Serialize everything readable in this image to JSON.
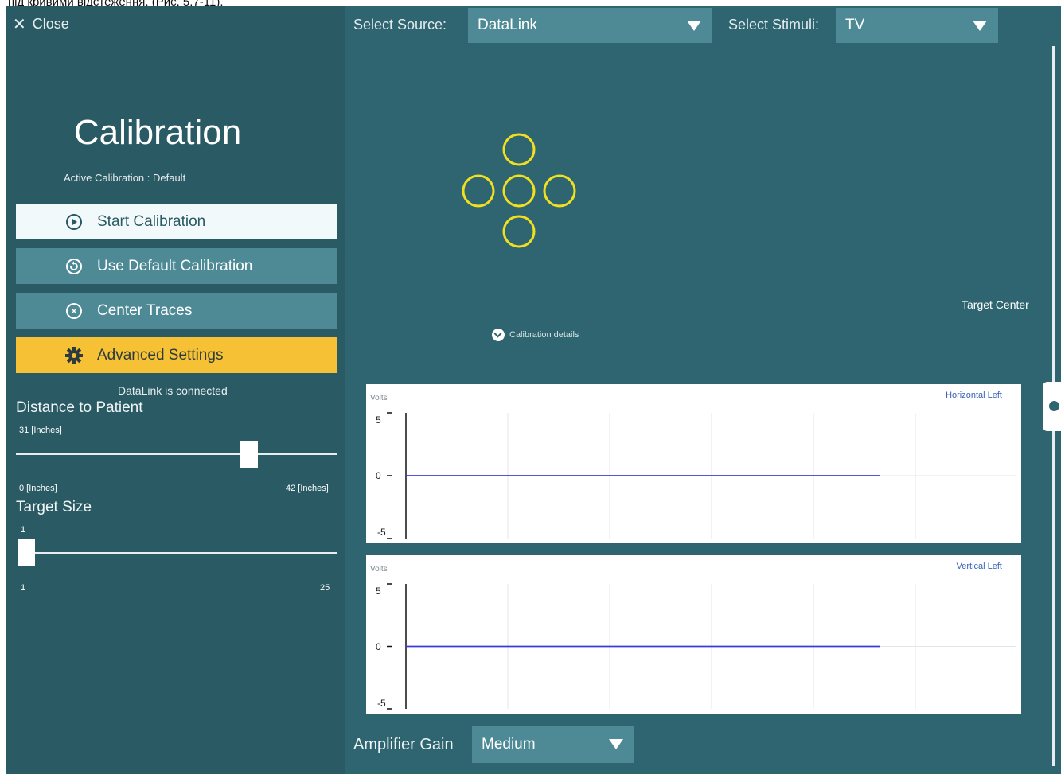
{
  "doc_caption": "під кривими відстеження, (Рис. 5.7-11).",
  "left_panel": {
    "close_label": "Close",
    "title": "Calibration",
    "active_calibration": "Active Calibration : Default",
    "buttons": {
      "start": "Start Calibration",
      "use_default": "Use Default Calibration",
      "center_traces": "Center Traces",
      "advanced": "Advanced Settings"
    },
    "connection_status": "DataLink is connected",
    "distance": {
      "label": "Distance to Patient",
      "current": "31 [Inches]",
      "min": "0 [Inches]",
      "max": "42 [Inches]",
      "value": 31,
      "range": [
        0,
        42
      ]
    },
    "target_size": {
      "label": "Target Size",
      "current": "1",
      "min": "1",
      "max": "25",
      "value": 1,
      "range": [
        1,
        25
      ]
    }
  },
  "topbar": {
    "source_label": "Select Source:",
    "source_value": "DataLink",
    "stimuli_label": "Select Stimuli:",
    "stimuli_value": "TV"
  },
  "stimulus": {
    "target_center_label": "Target Center",
    "calibration_details": "Calibration details",
    "target_color": "#f0e020"
  },
  "plots": [
    {
      "title": "Horizontal Left",
      "ylabel": "Volts",
      "y_ticks": [
        "5",
        "0",
        "-5"
      ],
      "ylim": [
        -5,
        5
      ],
      "trace_value": 0,
      "trace_color": "#3b3bd6"
    },
    {
      "title": "Vertical Left",
      "ylabel": "Volts",
      "y_ticks": [
        "5",
        "0",
        "-5"
      ],
      "ylim": [
        -5,
        5
      ],
      "trace_value": 0,
      "trace_color": "#3b3bd6"
    }
  ],
  "amplifier": {
    "label": "Amplifier Gain",
    "value": "Medium"
  }
}
